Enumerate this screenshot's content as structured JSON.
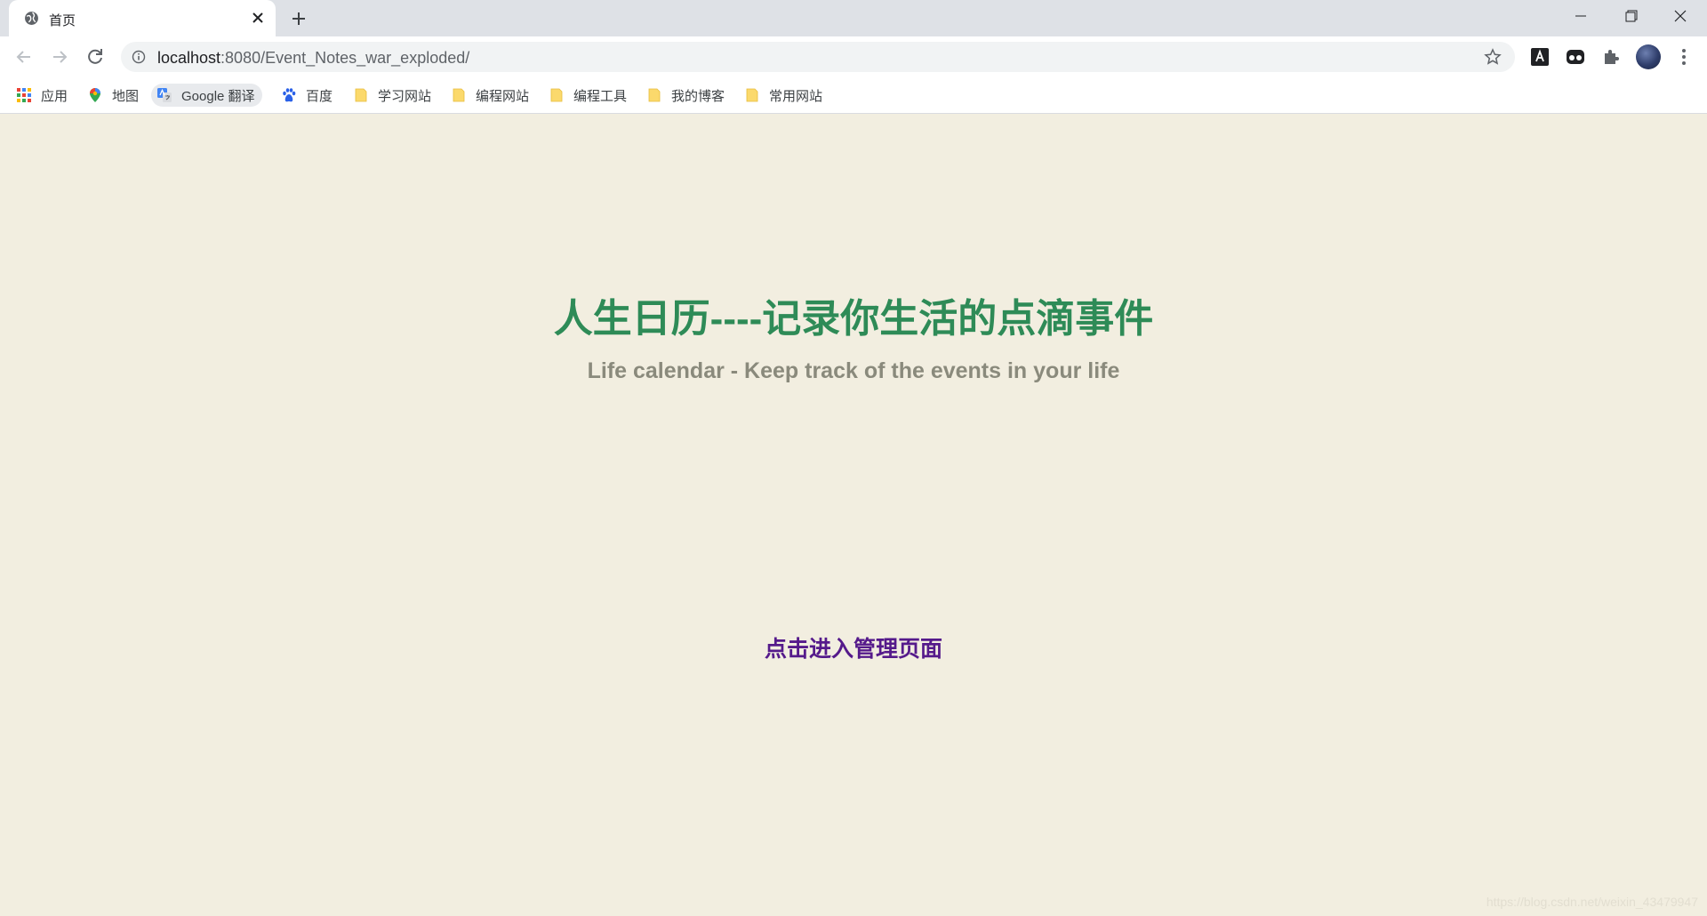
{
  "browser": {
    "tab": {
      "title": "首页"
    },
    "address_bar": {
      "host": "localhost",
      "rest": ":8080/Event_Notes_war_exploded/"
    },
    "bookmarks": [
      {
        "label": "应用",
        "icon": "apps-grid-icon"
      },
      {
        "label": "地图",
        "icon": "map-pin-icon"
      },
      {
        "label": "Google 翻译",
        "icon": "google-translate-icon"
      },
      {
        "label": "百度",
        "icon": "baidu-paw-icon"
      },
      {
        "label": "学习网站",
        "icon": "folder-icon"
      },
      {
        "label": "编程网站",
        "icon": "folder-icon"
      },
      {
        "label": "编程工具",
        "icon": "folder-icon"
      },
      {
        "label": "我的博客",
        "icon": "folder-icon"
      },
      {
        "label": "常用网站",
        "icon": "folder-icon"
      }
    ]
  },
  "page": {
    "title": "人生日历----记录你生活的点滴事件",
    "subtitle": "Life calendar - Keep track of the events in your life",
    "enter_link": "点击进入管理页面",
    "watermark": "https://blog.csdn.net/weixin_43479947"
  },
  "colors": {
    "page_background": "#f2eee0",
    "title": "#2e8b57",
    "subtitle": "#8a8a7c",
    "link": "#551a8b"
  }
}
